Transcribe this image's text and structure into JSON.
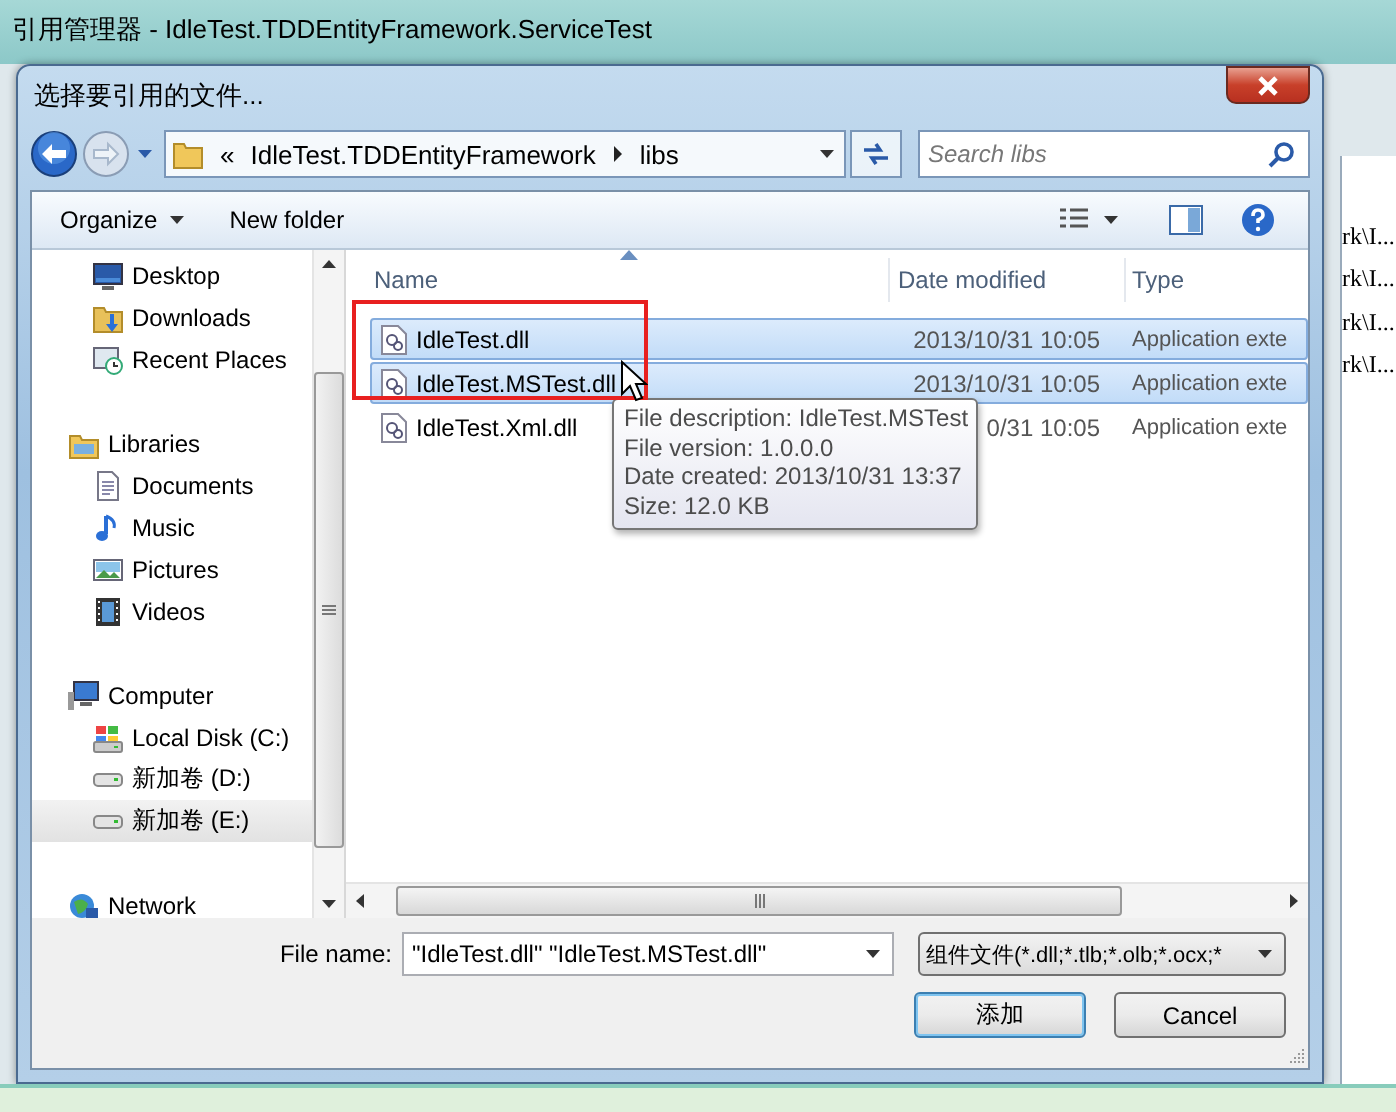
{
  "window": {
    "title": "引用管理器 - IdleTest.TDDEntityFramework.ServiceTest"
  },
  "background_list": [
    "rk\\I...",
    "rk\\I...",
    "rk\\I...",
    "rk\\I..."
  ],
  "dialog": {
    "title": "选择要引用的文件...",
    "address": {
      "chevron": "«",
      "segments": [
        "IdleTest.TDDEntityFramework",
        "libs"
      ]
    },
    "search": {
      "placeholder": "Search libs"
    },
    "toolbar": {
      "organize": "Organize",
      "new_folder": "New folder"
    },
    "navigation": [
      {
        "children": [
          {
            "label": "Desktop",
            "kind": "desktop",
            "selected": false
          },
          {
            "label": "Downloads",
            "kind": "downloads",
            "selected": false
          },
          {
            "label": "Recent Places",
            "kind": "recent",
            "selected": false
          }
        ]
      },
      {
        "label": "Libraries",
        "kind": "library",
        "selected": false,
        "children": [
          {
            "label": "Documents",
            "kind": "document",
            "selected": false
          },
          {
            "label": "Music",
            "kind": "music",
            "selected": false
          },
          {
            "label": "Pictures",
            "kind": "pictures",
            "selected": false
          },
          {
            "label": "Videos",
            "kind": "video",
            "selected": false
          }
        ]
      },
      {
        "label": "Computer",
        "kind": "computer",
        "selected": false,
        "children": [
          {
            "label": "Local Disk (C:)",
            "kind": "system_disk",
            "selected": false
          },
          {
            "label": "新加卷 (D:)",
            "kind": "drive",
            "selected": false
          },
          {
            "label": "新加卷 (E:)",
            "kind": "drive",
            "selected": true
          }
        ]
      },
      {
        "label": "Network",
        "kind": "network",
        "selected": false
      }
    ],
    "columns": [
      {
        "label": "Name",
        "sorted": true
      },
      {
        "label": "Date modified",
        "sorted": false
      },
      {
        "label": "Type",
        "sorted": false
      }
    ],
    "files": [
      {
        "name": "IdleTest.dll",
        "date": "2013/10/31 10:05",
        "type": "Application exte",
        "selected": true
      },
      {
        "name": "IdleTest.MSTest.dll",
        "date": "2013/10/31 10:05",
        "type": "Application exte",
        "selected": true
      },
      {
        "name": "IdleTest.Xml.dll",
        "date": "0/31 10:05",
        "type": "Application exte",
        "selected": false
      }
    ],
    "tooltip": [
      "File description: IdleTest.MSTest",
      "File version: 1.0.0.0",
      "Date created: 2013/10/31 13:37",
      "Size: 12.0 KB"
    ],
    "file_name": {
      "label": "File name:",
      "value": "\"IdleTest.dll\" \"IdleTest.MSTest.dll\""
    },
    "filter": {
      "value": "组件文件(*.dll;*.tlb;*.olb;*.ocx;*"
    },
    "buttons": [
      {
        "label": "添加",
        "default": true
      },
      {
        "label": "Cancel",
        "default": false
      }
    ]
  }
}
